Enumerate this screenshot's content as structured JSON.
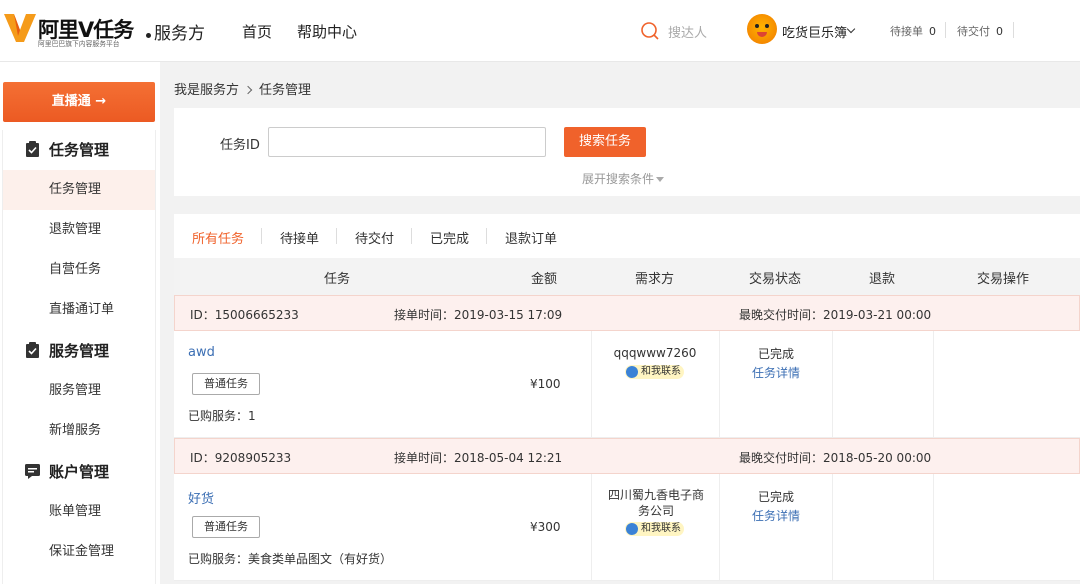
{
  "header": {
    "logo_main": "阿里V任务",
    "logo_sub": "阿里巴巴旗下内容服务平台",
    "role": "服务方",
    "nav": [
      "首页",
      "帮助中心"
    ],
    "search_placeholder": "搜达人",
    "username": "吃货巨乐簿",
    "pending_accept_label": "待接单",
    "pending_accept_count": "0",
    "pending_delivery_label": "待交付",
    "pending_delivery_count": "0"
  },
  "sidebar": {
    "live_button": "直播通 →",
    "groups": [
      {
        "label": "任务管理",
        "items": [
          "任务管理",
          "退款管理",
          "自营任务",
          "直播通订单"
        ]
      },
      {
        "label": "服务管理",
        "items": [
          "服务管理",
          "新增服务"
        ]
      },
      {
        "label": "账户管理",
        "items": [
          "账单管理",
          "保证金管理"
        ]
      }
    ],
    "active_item": "任务管理"
  },
  "breadcrumb": [
    "我是服务方",
    "任务管理"
  ],
  "search": {
    "label": "任务ID",
    "value": "",
    "button": "搜索任务",
    "expand": "展开搜索条件"
  },
  "tabs": [
    "所有任务",
    "待接单",
    "待交付",
    "已完成",
    "退款订单"
  ],
  "active_tab": "所有任务",
  "columns": [
    "任务",
    "金额",
    "需求方",
    "交易状态",
    "退款",
    "交易操作"
  ],
  "orders": [
    {
      "id_label": "ID：15006665233",
      "accept_time": "接单时间：2019-03-15 17:09",
      "deadline": "最晚交付时间：2019-03-21 00:00",
      "task_name": "awd",
      "tag": "普通任务",
      "bought": "已购服务：1",
      "amount": "¥100",
      "buyer": "qqqwww7260",
      "contact": "和我联系",
      "status": "已完成",
      "detail": "任务详情"
    },
    {
      "id_label": "ID：9208905233",
      "accept_time": "接单时间：2018-05-04 12:21",
      "deadline": "最晚交付时间：2018-05-20 00:00",
      "task_name": "好货",
      "tag": "普通任务",
      "bought": "已购服务：美食类单品图文（有好货）",
      "amount": "¥300",
      "buyer": "四川蜀九香电子商务公司",
      "contact": "和我联系",
      "status": "已完成",
      "detail": "任务详情"
    }
  ],
  "colors": {
    "accent": "#f0622b",
    "link": "#3c6fb4",
    "row_head_bg": "#fdf0ee"
  }
}
